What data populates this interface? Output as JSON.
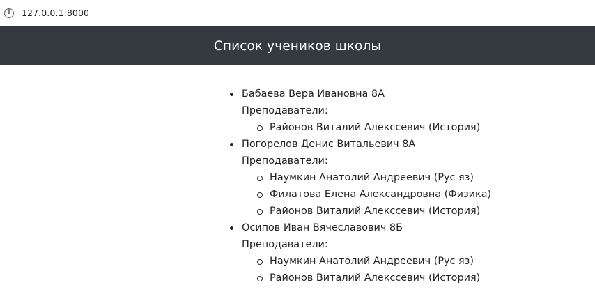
{
  "browser": {
    "url": "127.0.0.1:8000"
  },
  "header": {
    "title": "Список учеников школы"
  },
  "teachers_label": "Преподаватели:",
  "students": [
    {
      "name": "Бабаева Вера Ивановна 8А",
      "teachers": [
        "Районов Виталий Алекссевич (История)"
      ]
    },
    {
      "name": "Погорелов Денис Витальевич 8А",
      "teachers": [
        "Наумкин Анатолий Андреевич (Рус яз)",
        "Филатова Елена Александровна (Физика)",
        "Районов Виталий Алекссевич (История)"
      ]
    },
    {
      "name": "Осипов Иван Вячеславович 8Б",
      "teachers": [
        "Наумкин Анатолий Андреевич (Рус яз)",
        "Районов Виталий Алекссевич (История)"
      ]
    }
  ]
}
